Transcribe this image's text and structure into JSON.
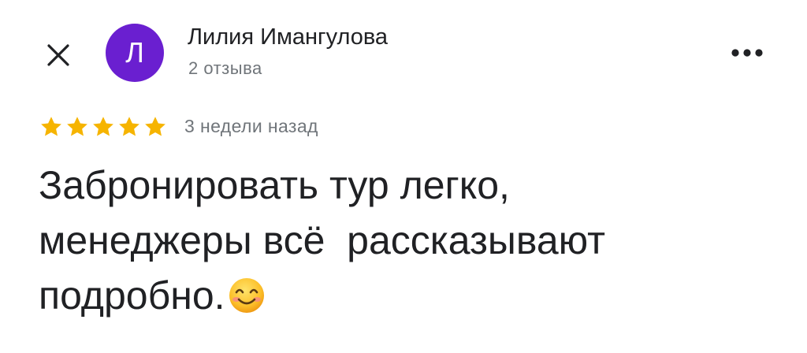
{
  "header": {
    "close_icon": "close-icon",
    "avatar_letter": "Л",
    "avatar_color": "#6a1fd0",
    "author_name": "Лилия Имангулова",
    "author_reviews": "2 отзыва",
    "more_icon": "more-horiz-icon"
  },
  "review": {
    "rating": 5,
    "max_rating": 5,
    "star_color": "#f6b400",
    "date": "3 недели назад",
    "line1": "Забронировать тур легко,",
    "line2": "менеджеры всё  рассказывают",
    "line3": "подробно.",
    "emoji": "smiling-face-icon"
  }
}
